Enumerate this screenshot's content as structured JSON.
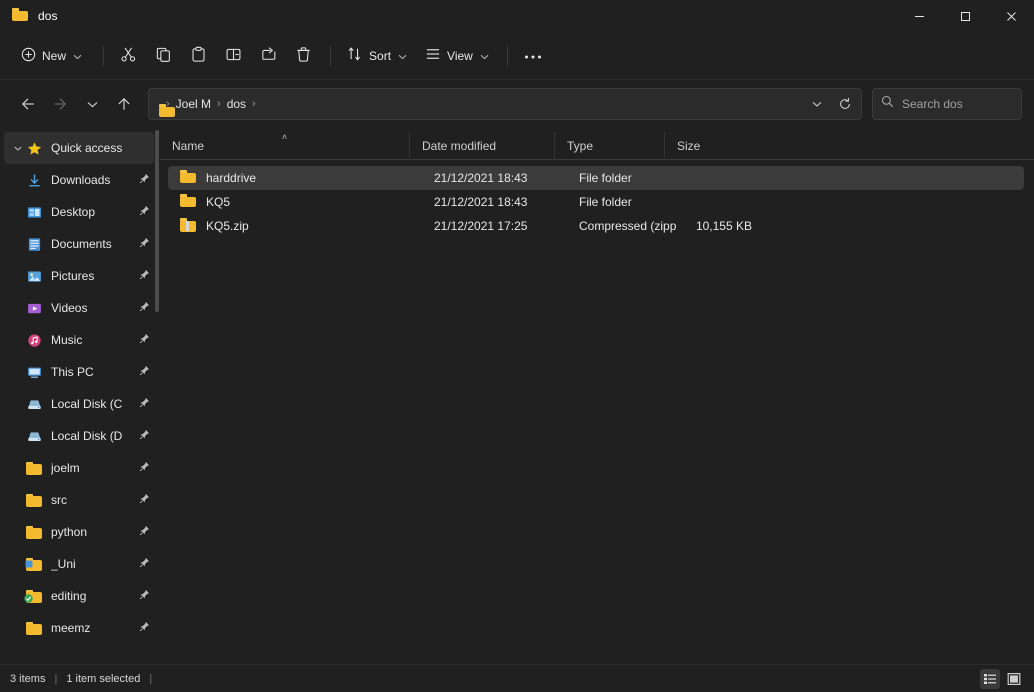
{
  "window": {
    "title": "dos",
    "title_icon": "folder-icon",
    "controls": {
      "minimize": "minimize-icon",
      "maximize": "maximize-icon",
      "close": "close-icon"
    }
  },
  "command_bar": {
    "new_label": "New",
    "items": [
      {
        "name": "cut",
        "icon": "scissors-icon"
      },
      {
        "name": "copy",
        "icon": "copy-icon"
      },
      {
        "name": "paste",
        "icon": "clipboard-icon"
      },
      {
        "name": "rename",
        "icon": "rename-icon"
      },
      {
        "name": "share",
        "icon": "share-icon"
      },
      {
        "name": "delete",
        "icon": "trash-icon"
      }
    ],
    "sort_label": "Sort",
    "view_label": "View",
    "overflow_label": "···"
  },
  "navigation": {
    "back": "back-arrow-icon",
    "forward": "forward-arrow-icon",
    "recent": "chevron-down-icon",
    "up": "up-arrow-icon",
    "breadcrumb": [
      "Joel M",
      "dos"
    ],
    "breadcrumb_separator": "›",
    "address_dropdown": "chevron-down-icon",
    "refresh": "refresh-icon"
  },
  "search": {
    "placeholder": "Search dos",
    "icon": "search-icon"
  },
  "sidebar": {
    "header": {
      "label": "Quick access",
      "icon": "star-icon",
      "expanded": true
    },
    "items": [
      {
        "label": "Downloads",
        "icon": "download-icon",
        "pinned": true
      },
      {
        "label": "Desktop",
        "icon": "desktop-icon",
        "pinned": true
      },
      {
        "label": "Documents",
        "icon": "documents-icon",
        "pinned": true
      },
      {
        "label": "Pictures",
        "icon": "pictures-icon",
        "pinned": true
      },
      {
        "label": "Videos",
        "icon": "videos-icon",
        "pinned": true
      },
      {
        "label": "Music",
        "icon": "music-icon",
        "pinned": true
      },
      {
        "label": "This PC",
        "icon": "this-pc-icon",
        "pinned": true
      },
      {
        "label": "Local Disk (C",
        "icon": "disk-icon",
        "pinned": true
      },
      {
        "label": "Local Disk (D",
        "icon": "disk-icon",
        "pinned": true
      },
      {
        "label": "joelm",
        "icon": "folder-icon",
        "pinned": true
      },
      {
        "label": "src",
        "icon": "folder-icon",
        "pinned": true
      },
      {
        "label": "python",
        "icon": "folder-icon",
        "pinned": true
      },
      {
        "label": "_Uni",
        "icon": "folder-icon",
        "pinned": true
      },
      {
        "label": "editing",
        "icon": "folder-sync-icon",
        "pinned": true
      },
      {
        "label": "meemz",
        "icon": "folder-icon",
        "pinned": true
      }
    ]
  },
  "file_list": {
    "columns": [
      {
        "key": "name",
        "label": "Name",
        "sorted": true,
        "sort_indicator": "˄"
      },
      {
        "key": "date",
        "label": "Date modified"
      },
      {
        "key": "type",
        "label": "Type"
      },
      {
        "key": "size",
        "label": "Size"
      }
    ],
    "rows": [
      {
        "name": "harddrive",
        "date": "21/12/2021 18:43",
        "type": "File folder",
        "size": "",
        "icon": "folder-icon",
        "selected": true
      },
      {
        "name": "KQ5",
        "date": "21/12/2021 18:43",
        "type": "File folder",
        "size": "",
        "icon": "folder-icon",
        "selected": false
      },
      {
        "name": "KQ5.zip",
        "date": "21/12/2021 17:25",
        "type": "Compressed (zipp...",
        "size": "10,155 KB",
        "icon": "zip-icon",
        "selected": false
      }
    ]
  },
  "status_bar": {
    "item_count": "3 items",
    "selection": "1 item selected",
    "separator": "|",
    "details_view": "details-view-icon",
    "large_icons_view": "large-icons-view-icon"
  }
}
